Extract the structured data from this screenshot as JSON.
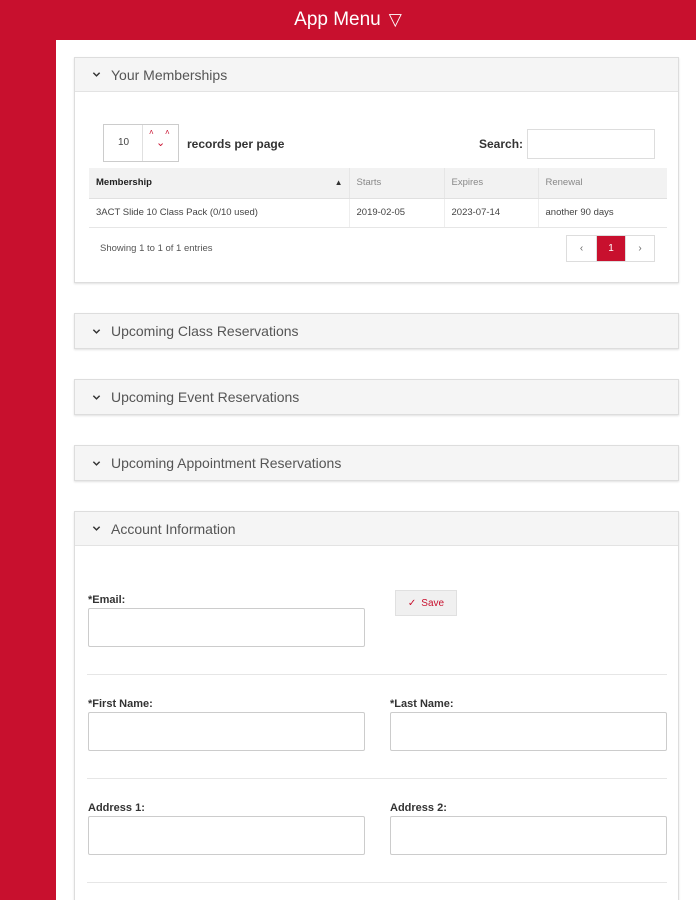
{
  "header": {
    "title": "App Menu",
    "arrow": "▽"
  },
  "panels": {
    "memberships": "Your Memberships",
    "class_reservations": "Upcoming Class Reservations",
    "event_reservations": "Upcoming Event Reservations",
    "appointment_reservations": "Upcoming Appointment Reservations",
    "account_information": "Account Information"
  },
  "memberships": {
    "page_length": "10",
    "records_per_page_label": "records per page",
    "search_label": "Search:",
    "search_value": "",
    "columns": [
      "Membership",
      "Starts",
      "Expires",
      "Renewal"
    ],
    "rows": [
      [
        "3ACT Slide 10 Class Pack (0/10 used)",
        "2019-02-05",
        "2023-07-14",
        "another 90 days"
      ]
    ],
    "info": "Showing 1 to 1 of 1 entries",
    "pager": {
      "prev": "‹",
      "current": "1",
      "next": "›"
    }
  },
  "account": {
    "email_label": "*Email:",
    "email_value": "",
    "save_label": "Save",
    "first_name_label": "*First Name:",
    "first_name_value": "",
    "last_name_label": "*Last Name:",
    "last_name_value": "",
    "address1_label": "Address 1:",
    "address1_value": "",
    "address2_label": "Address 2:",
    "address2_value": ""
  },
  "colors": {
    "brand": "#c8102e",
    "panel_header": "#f5f5f5"
  },
  "icons": {
    "panel_toggle": "chevron-down-icon",
    "save": "check-icon"
  }
}
